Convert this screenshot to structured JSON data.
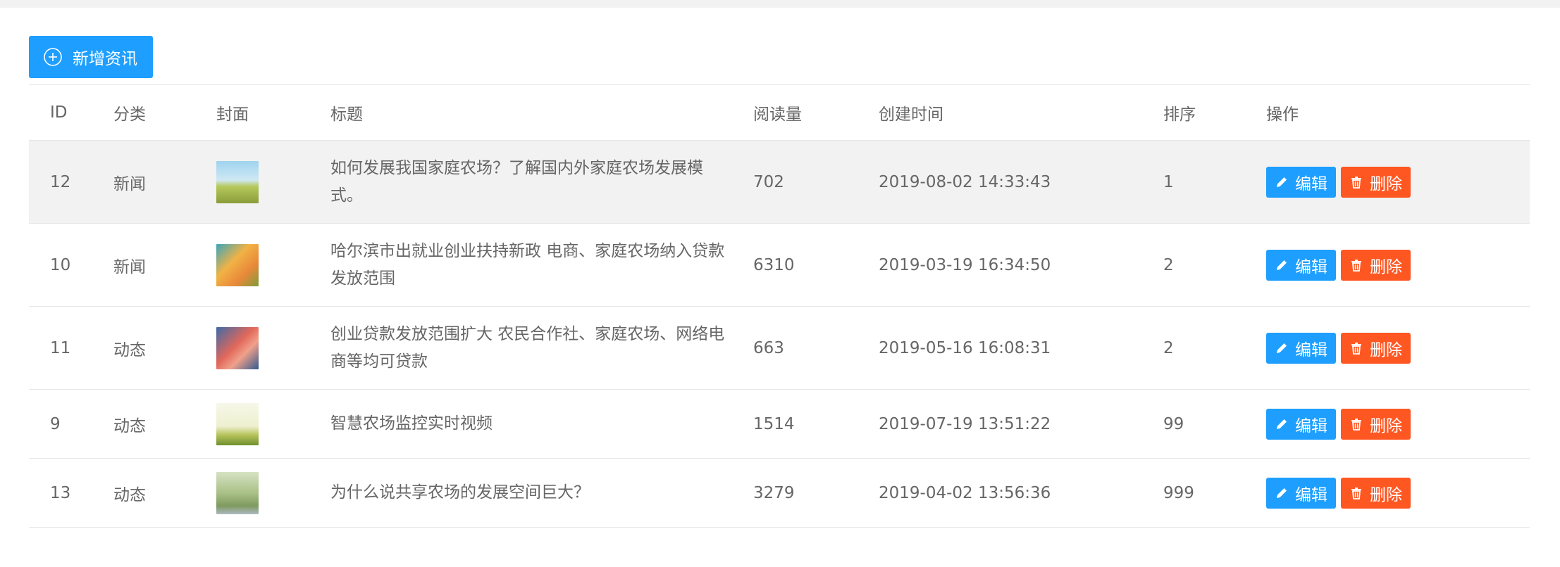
{
  "toolbar": {
    "add_label": "新增资讯"
  },
  "table": {
    "headers": {
      "id": "ID",
      "category": "分类",
      "cover": "封面",
      "title": "标题",
      "views": "阅读量",
      "created": "创建时间",
      "sort": "排序",
      "actions": "操作"
    },
    "rows": [
      {
        "id": "12",
        "category": "新闻",
        "title": "如何发展我国家庭农场？了解国内外家庭农场发展模式。",
        "views": "702",
        "created": "2019-08-02 14:33:43",
        "sort": "1"
      },
      {
        "id": "10",
        "category": "新闻",
        "title": "哈尔滨市出就业创业扶持新政 电商、家庭农场纳入贷款发放范围",
        "views": "6310",
        "created": "2019-03-19 16:34:50",
        "sort": "2"
      },
      {
        "id": "11",
        "category": "动态",
        "title": "创业贷款发放范围扩大 农民合作社、家庭农场、网络电商等均可贷款",
        "views": "663",
        "created": "2019-05-16 16:08:31",
        "sort": "2"
      },
      {
        "id": "9",
        "category": "动态",
        "title": "智慧农场监控实时视频",
        "views": "1514",
        "created": "2019-07-19 13:51:22",
        "sort": "99"
      },
      {
        "id": "13",
        "category": "动态",
        "title": "为什么说共享农场的发展空间巨大？",
        "views": "3279",
        "created": "2019-04-02 13:56:36",
        "sort": "999"
      }
    ],
    "edit_label": "编辑",
    "delete_label": "删除"
  },
  "colors": {
    "primary": "#1e9fff",
    "danger": "#ff5722",
    "hover_row": "#f2f2f2"
  },
  "icons": {
    "add": "plus-circle-icon",
    "edit": "pencil-icon",
    "delete": "trash-icon"
  }
}
